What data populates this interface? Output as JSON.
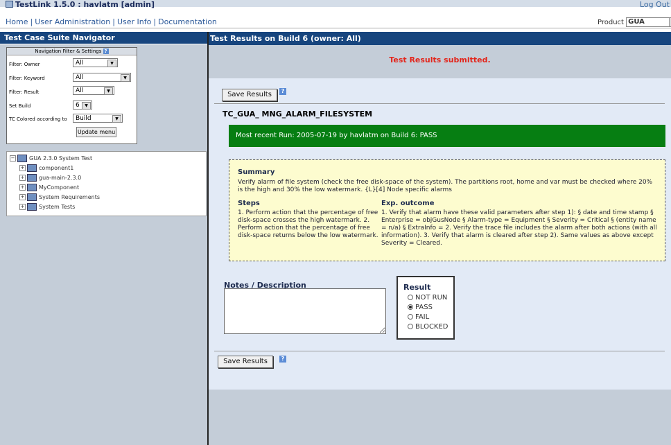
{
  "app": {
    "title": "TestLink 1.5.0 : havlatm [admin]",
    "logout": "Log Out"
  },
  "menu": {
    "items": [
      "Home",
      "User Administration",
      "User Info",
      "Documentation"
    ]
  },
  "product": {
    "label": "Product",
    "value": "GUA"
  },
  "navigator": {
    "title": "Test Case Suite Navigator",
    "filter_title": "Navigation Filter & Settings",
    "filters": [
      {
        "label": "Filter: Owner",
        "value": "All"
      },
      {
        "label": "Filter: Keyword",
        "value": "All"
      },
      {
        "label": "Filter: Result",
        "value": "All"
      },
      {
        "label": "Set Build",
        "value": "6"
      },
      {
        "label": "TC Colored according to",
        "value": "Build"
      }
    ],
    "update_button": "Update menu",
    "tree": {
      "root": "GUA 2.3.0 System Test",
      "children": [
        "component1",
        "gua-main-2.3.0",
        "MyComponent",
        "System Requirements",
        "System Tests"
      ]
    }
  },
  "main": {
    "title": "Test Results on Build 6 (owner: All)",
    "message": "Test Results submitted.",
    "save_button": "Save Results",
    "tc_title": "TC_GUA_ MNG_ALARM_FILESYSTEM",
    "recent_run": "Most recent Run: 2005-07-19 by havlatm on Build 6: PASS",
    "summary_heading": "Summary",
    "summary_text": "Verify alarm of file system (check the free disk-space of the system). The partitions root, home and var must be checked where 20% is the high and 30% the low watermark. {L}[4] Node specific alarms",
    "steps_heading": "Steps",
    "steps_text": "1. Perform action that the percentage of free disk-space crosses the high watermark. 2. Perform action that the percentage of free disk-space returns below the low watermark.",
    "outcome_heading": "Exp. outcome",
    "outcome_text": "1. Verify that alarm have these valid parameters after step 1): § date and time stamp § Enterprise = objGusNode § Alarm-type = Equipment § Severity = Critical § (entity name = n/a) § ExtraInfo = 2. Verify the trace file includes the alarm after both actions (with all information). 3. Verify that alarm is cleared after step 2). Same values as above except Severity = Cleared.",
    "notes_label": "Notes / Description",
    "notes_value": "",
    "result_heading": "Result",
    "result_options": [
      "NOT RUN",
      "PASS",
      "FAIL",
      "BLOCKED"
    ],
    "result_selected": "PASS",
    "colors": {
      "header_blue": "#17457e",
      "pass_green": "#067e12",
      "message_red": "#e3241a"
    }
  }
}
